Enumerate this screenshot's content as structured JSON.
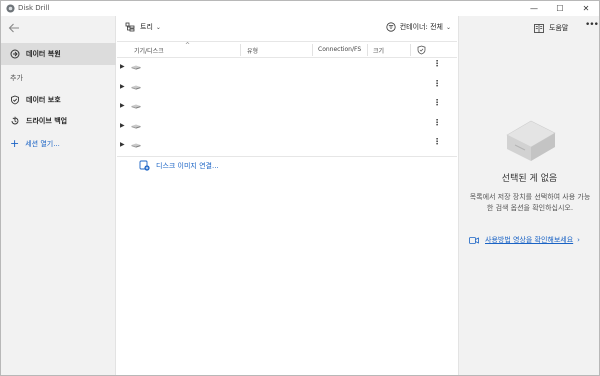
{
  "app": {
    "title": "Disk Drill"
  },
  "window_controls": {
    "minimize": "—",
    "maximize": "☐",
    "close": "✕"
  },
  "sidebar": {
    "items": [
      {
        "label": "데이터 복원",
        "icon": "recovery-icon",
        "active": true
      }
    ],
    "section_label": "추가",
    "extra_items": [
      {
        "label": "데이터 보호",
        "icon": "shield-icon"
      },
      {
        "label": "드라이브 백업",
        "icon": "backup-icon"
      }
    ],
    "open_session": {
      "plus": "+",
      "label": "세션 열기..."
    }
  },
  "toolbar": {
    "view_label": "트리",
    "filter_label": "컨테이너: 전체"
  },
  "table": {
    "columns": [
      "기기/디스크",
      "유형",
      "Connection/FS",
      "크기"
    ],
    "row_count": 5,
    "row_menu": "⋮",
    "expander": "▶"
  },
  "disk_image_link": "디스크 이미지 연결...",
  "right_panel": {
    "help_label": "도움말",
    "more": "•••",
    "empty_title": "선택된 게 없음",
    "empty_desc": "목록에서 저장 장치를 선택하여 사용 가능한 검색 옵션을 확인하십시오.",
    "howto_link": "사용방법 영상을 확인해보세요",
    "howto_arrow": "›"
  },
  "colors": {
    "accent": "#1a63c5",
    "sidebar_bg": "#f2f2f2",
    "active_bg": "#dcdcdc"
  }
}
